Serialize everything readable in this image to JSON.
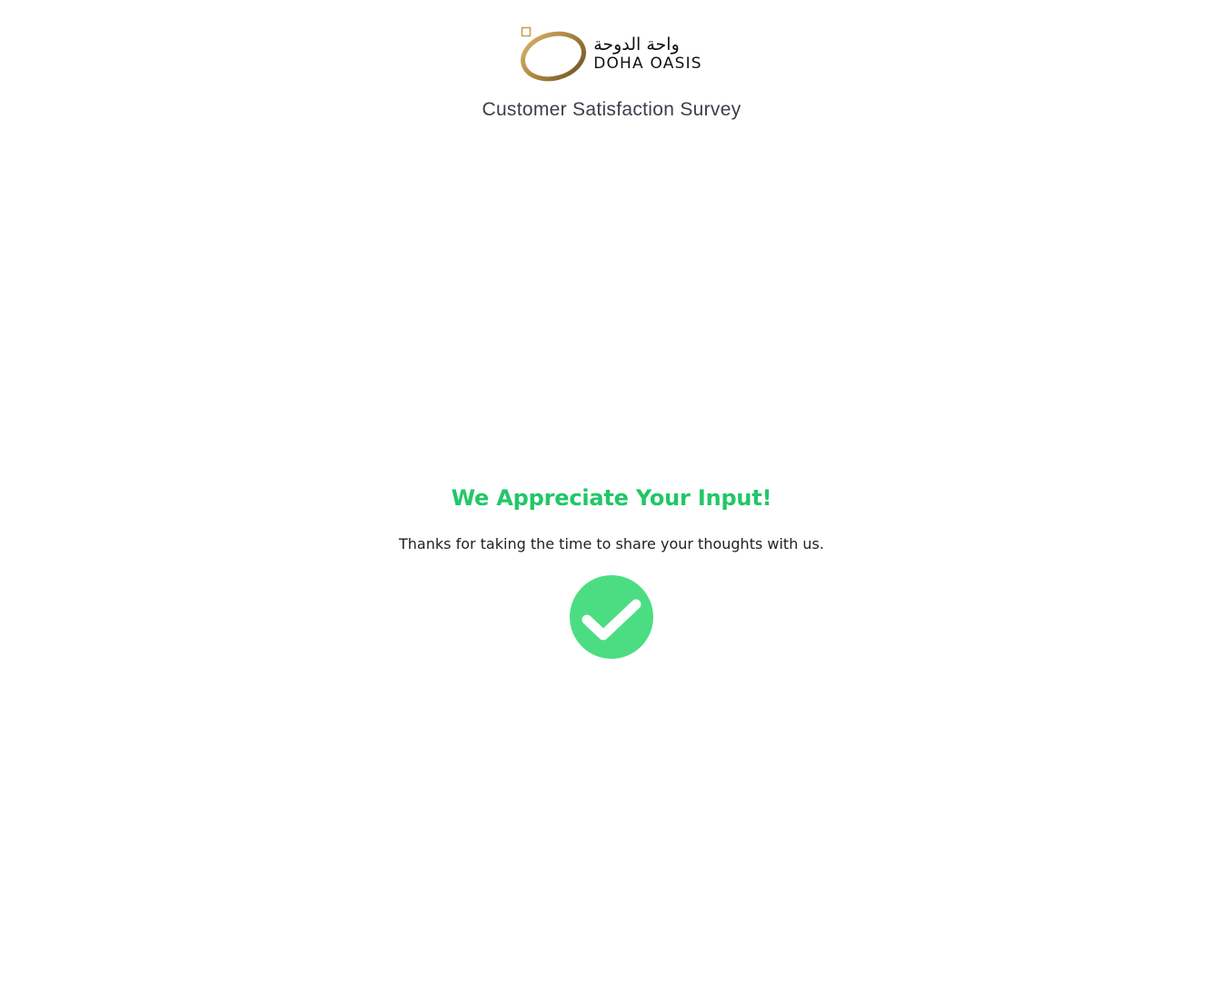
{
  "brand": {
    "arabic_name": "واحة الدوحة",
    "english_name": "DOHA OASIS",
    "accent_gold": "#b08d4a",
    "icon": "logo-ring-icon"
  },
  "header": {
    "title": "Customer Satisfaction Survey"
  },
  "confirmation": {
    "heading": "We Appreciate Your Input!",
    "message": "Thanks for taking the time to share your thoughts with us.",
    "heading_color": "#21c767",
    "icon": "check-circle-icon",
    "icon_color": "#4cdd82"
  }
}
